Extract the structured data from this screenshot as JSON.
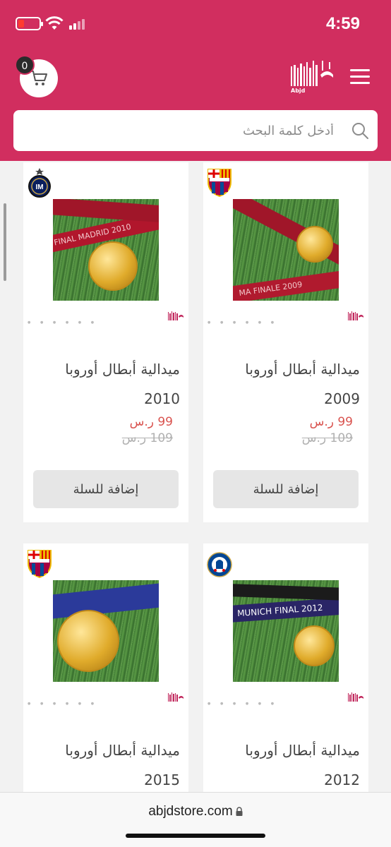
{
  "status_bar": {
    "time": "4:59"
  },
  "header": {
    "cart_count": "0",
    "logo_text": "Abjd",
    "search_placeholder": "أدخل كلمة البحث"
  },
  "products": [
    {
      "title": "ميدالية أبطال أوروبا",
      "year": "2009",
      "price": "99 ر.س",
      "old_price": "109 ر.س",
      "button": "إضافة للسلة",
      "club": "fc-barcelona-crest-icon",
      "ribbon_text": "MA FINALE 2009"
    },
    {
      "title": "ميدالية أبطال أوروبا",
      "year": "2010",
      "price": "99 ر.س",
      "old_price": "109 ر.س",
      "button": "إضافة للسلة",
      "club": "inter-milan-crest-icon",
      "ribbon_text": "FINAL MADRID 2010"
    },
    {
      "title": "ميدالية أبطال أوروبا",
      "year": "2012",
      "price": "",
      "old_price": "",
      "button": "",
      "club": "chelsea-crest-icon",
      "ribbon_text": "MUNICH FINAL 2012"
    },
    {
      "title": "ميدالية أبطال أوروبا",
      "year": "2015",
      "price": "",
      "old_price": "",
      "button": "",
      "club": "fc-barcelona-crest-icon",
      "ribbon_text": ""
    }
  ],
  "browser": {
    "url": "abjdstore.com"
  },
  "colors": {
    "brand": "#d12e5f",
    "price": "#d9534f"
  }
}
